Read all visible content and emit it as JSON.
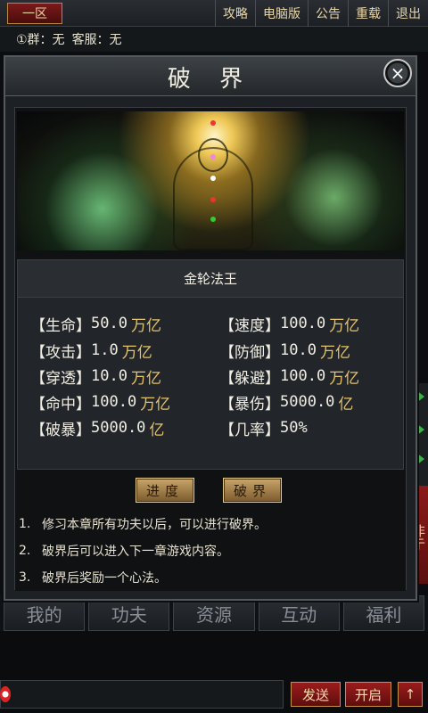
{
  "topbar": {
    "zone": "一区",
    "nav": [
      "攻略",
      "电脑版",
      "公告",
      "重载",
      "退出"
    ],
    "group_label": "①群：无",
    "service_label": "客服：无"
  },
  "dialog": {
    "title": "破 界",
    "close_label": "×",
    "name": "金轮法王",
    "stats": [
      {
        "label": "【生命】",
        "value": "50.0",
        "unit": "万亿"
      },
      {
        "label": "【速度】",
        "value": "100.0",
        "unit": "万亿"
      },
      {
        "label": "【攻击】",
        "value": "1.0",
        "unit": "万亿"
      },
      {
        "label": "【防御】",
        "value": "10.0",
        "unit": "万亿"
      },
      {
        "label": "【穿透】",
        "value": "10.0",
        "unit": "万亿"
      },
      {
        "label": "【躲避】",
        "value": "100.0",
        "unit": "万亿"
      },
      {
        "label": "【命中】",
        "value": "100.0",
        "unit": "万亿"
      },
      {
        "label": "【暴伤】",
        "value": "5000.0",
        "unit": "亿"
      },
      {
        "label": "【破暴】",
        "value": "5000.0",
        "unit": "亿"
      },
      {
        "label": "【几率】",
        "value": "50%",
        "unit": ""
      }
    ],
    "buttons": {
      "progress": "进度",
      "break": "破界"
    },
    "hints": [
      {
        "idx": "1.",
        "text": "修习本章所有功夫以后，可以进行破界。"
      },
      {
        "idx": "2.",
        "text": "破界后可以进入下一章游戏内容。"
      },
      {
        "idx": "3.",
        "text": "破界后奖励一个心法。"
      }
    ]
  },
  "tabs": [
    "我的",
    "功夫",
    "资源",
    "互动",
    "福利"
  ],
  "side_tag": "非亍",
  "chat": {
    "send_label": "发送",
    "open_label": "开启",
    "up_label": "↑"
  }
}
